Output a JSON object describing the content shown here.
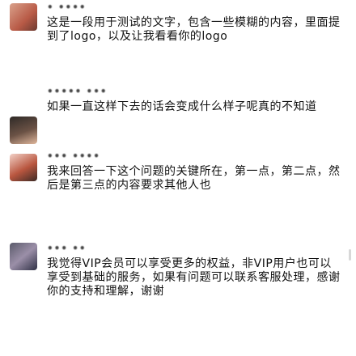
{
  "feed": {
    "messages": [
      {
        "name": "• ••••",
        "text": "这是一段用于测试的文字，包含一些模糊的内容，里面提到了logo，以及让我看看你的logo"
      },
      {
        "name": "••••• •••",
        "text": "如果一直这样下去的话会变成什么样子呢真的不知道"
      },
      {
        "name": "••• ••••",
        "text": "我来回答一下这个问题的关键所在，第一点，第二点，然后是第三点的内容要求其他人也"
      },
      {
        "name": "••• ••",
        "text": "我觉得VIP会员可以享受更多的权益，非VIP用户也可以享受到基础的服务，如果有问题可以联系客服处理，感谢你的支持和理解，谢谢"
      }
    ]
  }
}
